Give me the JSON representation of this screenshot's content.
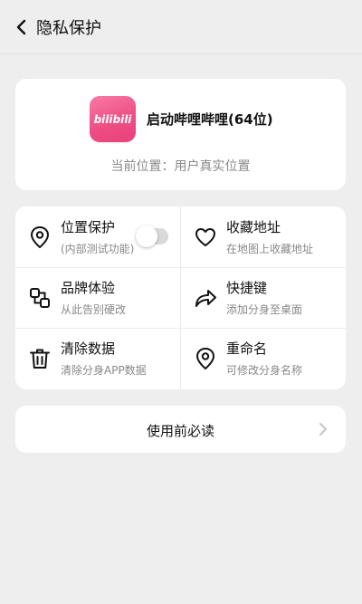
{
  "header": {
    "title": "隐私保护"
  },
  "app": {
    "name": "启动哔哩哔哩(64位)",
    "logo_text": "bilibili",
    "location_text": "当前位置：用户真实位置"
  },
  "features": [
    {
      "title": "位置保护",
      "subtitle": "(内部测试功能)",
      "icon": "location-pin-icon",
      "toggle_on": false
    },
    {
      "title": "收藏地址",
      "subtitle": "在地图上收藏地址",
      "icon": "heart-icon"
    },
    {
      "title": "品牌体验",
      "subtitle": "从此告别硬改",
      "icon": "brand-swap-icon"
    },
    {
      "title": "快捷键",
      "subtitle": "添加分身至桌面",
      "icon": "share-arrow-icon"
    },
    {
      "title": "清除数据",
      "subtitle": "清除分身APP数据",
      "icon": "trash-icon"
    },
    {
      "title": "重命名",
      "subtitle": "可修改分身名称",
      "icon": "location-pin-icon"
    }
  ],
  "notice": {
    "label": "使用前必读"
  },
  "colors": {
    "background": "#eeeeee",
    "card": "#ffffff",
    "brand_pink": "#ee4f85",
    "muted_text": "#888888"
  }
}
